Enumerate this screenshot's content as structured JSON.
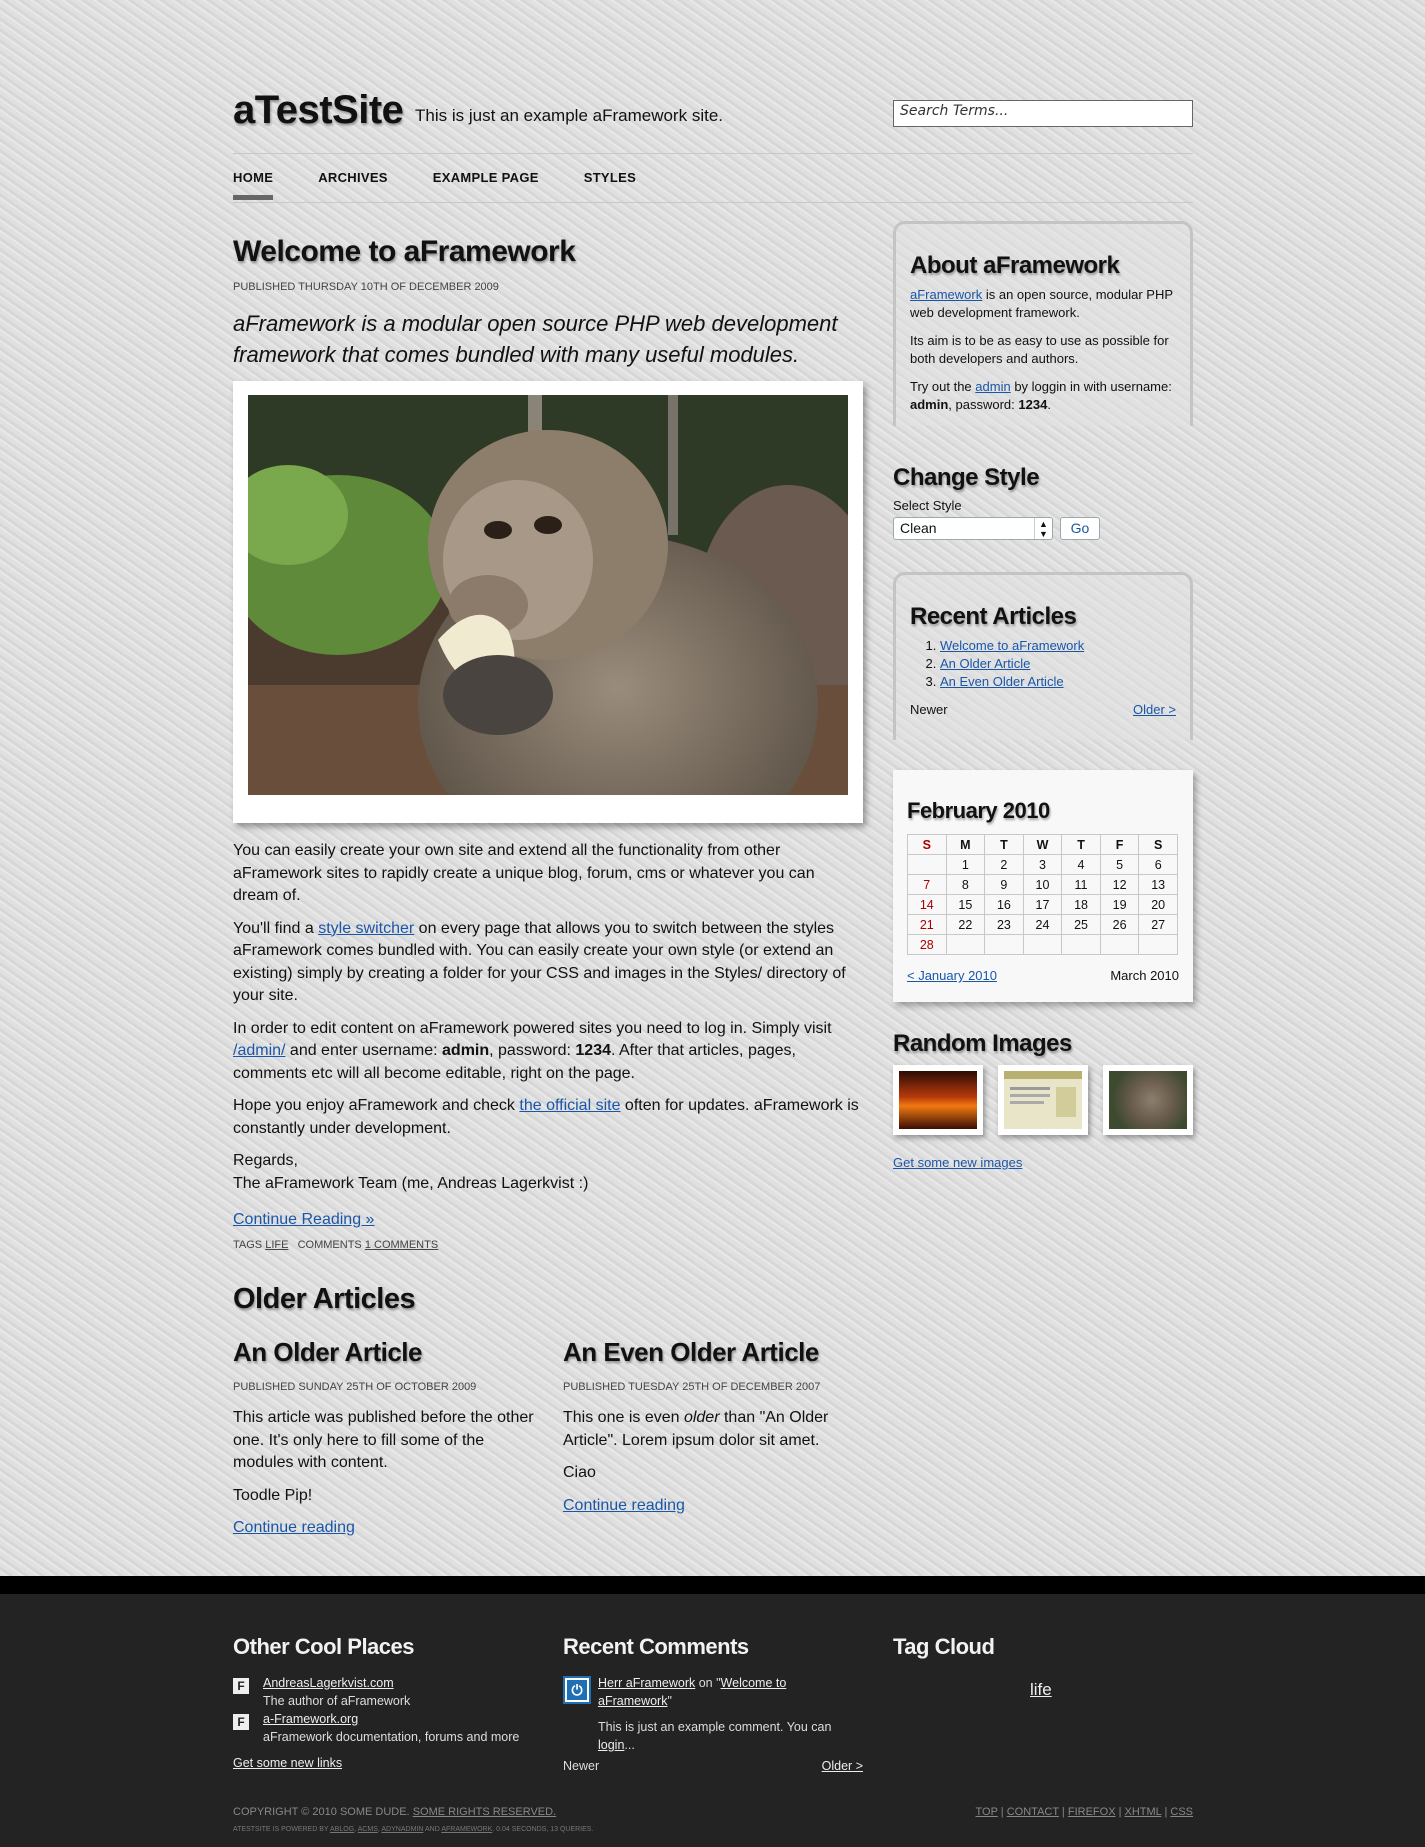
{
  "header": {
    "site_title": "aTestSite",
    "tagline": "This is just an example aFramework site.",
    "search_placeholder": "Search Terms..."
  },
  "nav": [
    {
      "label": "HOME",
      "active": true
    },
    {
      "label": "ARCHIVES"
    },
    {
      "label": "EXAMPLE PAGE"
    },
    {
      "label": "STYLES"
    }
  ],
  "article": {
    "title": "Welcome to aFramework",
    "published": "PUBLISHED THURSDAY 10TH OF DECEMBER 2009",
    "intro": "aFramework is a modular open source PHP web development framework that comes bundled with many useful modules.",
    "image_icon": "monkey-eating-banana-photo",
    "p1": "You can easily create your own site and extend all the functionality from other aFramework sites to rapidly create a unique blog, forum, cms or whatever you can dream of.",
    "p2_before": "You'll find a ",
    "p2_link": "style switcher",
    "p2_after": " on every page that allows you to switch between the styles aFramework comes bundled with. You can easily create your own style (or extend an existing) simply by creating a folder for your CSS and images in the Styles/ directory of your site.",
    "p3_before": "In order to edit content on aFramework powered sites you need to log in. Simply visit ",
    "p3_link": "/admin/",
    "p3_mid1": " and enter username: ",
    "p3_user": "admin",
    "p3_mid2": ", password: ",
    "p3_pass": "1234",
    "p3_after": ". After that articles, pages, comments etc will all become editable, right on the page.",
    "p4_before": "Hope you enjoy aFramework and check ",
    "p4_link": "the official site",
    "p4_after": " often for updates. aFramework is constantly under development.",
    "regards": "Regards,",
    "signature": "The aFramework Team (me, Andreas Lagerkvist :)",
    "continue": "Continue Reading »",
    "tags_label": "TAGS",
    "tag": "LIFE",
    "comments_label": "COMMENTS",
    "comments_link": "1 COMMENTS"
  },
  "older": {
    "heading": "Older Articles",
    "articles": [
      {
        "title": "An Older Article",
        "published": "PUBLISHED SUNDAY 25TH OF OCTOBER 2009",
        "p1": "This article was published before the other one. It's only here to fill some of the modules with content.",
        "p2": "Toodle Pip!",
        "continue": "Continue reading"
      },
      {
        "title": "An Even Older Article",
        "published": "PUBLISHED TUESDAY 25TH OF DECEMBER 2007",
        "p1_before": "This one is even ",
        "p1_em": "older",
        "p1_after": " than \"An Older Article\". Lorem ipsum dolor sit amet.",
        "p2": "Ciao",
        "continue": "Continue reading"
      }
    ]
  },
  "about": {
    "title": "About aFramework",
    "p1_link": "aFramework",
    "p1_after": " is an open source, modular PHP web development framework.",
    "p2": "Its aim is to be as easy to use as possible for both developers and authors.",
    "p3_before": "Try out the ",
    "p3_link": "admin",
    "p3_mid1": " by loggin in with username: ",
    "p3_user": "admin",
    "p3_mid2": ", password: ",
    "p3_pass": "1234",
    "p3_after": "."
  },
  "style": {
    "title": "Change Style",
    "label": "Select Style",
    "selected": "Clean",
    "go": "Go"
  },
  "recent": {
    "title": "Recent Articles",
    "items": [
      "Welcome to aFramework",
      "An Older Article",
      "An Even Older Article"
    ],
    "newer": "Newer",
    "older": "Older >"
  },
  "calendar": {
    "title": "February 2010",
    "days": [
      "S",
      "M",
      "T",
      "W",
      "T",
      "F",
      "S"
    ],
    "weeks": [
      [
        "",
        "1",
        "2",
        "3",
        "4",
        "5",
        "6"
      ],
      [
        "7",
        "8",
        "9",
        "10",
        "11",
        "12",
        "13"
      ],
      [
        "14",
        "15",
        "16",
        "17",
        "18",
        "19",
        "20"
      ],
      [
        "21",
        "22",
        "23",
        "24",
        "25",
        "26",
        "27"
      ],
      [
        "28",
        "",
        "",
        "",
        "",
        "",
        ""
      ]
    ],
    "prev": "< January 2010",
    "next": "March 2010",
    "sunday_color": "#aa0000"
  },
  "random_images": {
    "title": "Random Images",
    "images": [
      "sunset-photo",
      "website-screenshot",
      "monkey-photo"
    ],
    "link": "Get some new images"
  },
  "footer": {
    "cool_places": {
      "title": "Other Cool Places",
      "links": [
        {
          "label": "AndreasLagerkvist.com",
          "desc": "The author of aFramework",
          "icon": "F"
        },
        {
          "label": "a-Framework.org",
          "desc": "aFramework documentation, forums and more",
          "icon": "F"
        }
      ],
      "more": "Get some new links"
    },
    "comments": {
      "title": "Recent Comments",
      "author": "Herr aFramework",
      "on": " on \"",
      "article": "Welcome to aFramework",
      "close": "\"",
      "text": "This is just an example comment. You can ",
      "login": "login",
      "ellipsis": "...",
      "newer": "Newer",
      "older": "Older >"
    },
    "tags": {
      "title": "Tag Cloud",
      "tag": "life"
    },
    "copyright": "COPYRIGHT © 2010 SOME DUDE.",
    "rights": "SOME RIGHTS RESERVED.",
    "powered_before": "ATESTSITE IS POWERED BY",
    "powered_links": [
      "ABLOG",
      "ACMS",
      "ADYNADMIN",
      "AFRAMEWORK"
    ],
    "powered_after": "0.04 SECONDS, 13 QUERIES.",
    "right_links": [
      "TOP",
      "CONTACT",
      "FIREFOX",
      "XHTML",
      "CSS"
    ]
  },
  "colors": {
    "link": "#1a56a8",
    "footer_bg": "#232323"
  }
}
